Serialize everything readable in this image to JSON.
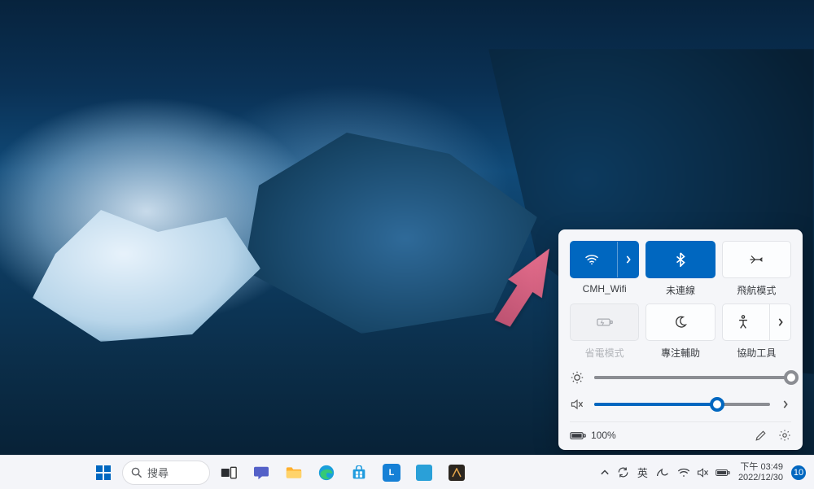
{
  "quick_settings": {
    "tiles": [
      {
        "key": "wifi",
        "label": "CMH_Wifi",
        "active": true,
        "split": true,
        "disabled": false
      },
      {
        "key": "bluetooth",
        "label": "未連線",
        "active": true,
        "split": false,
        "disabled": false
      },
      {
        "key": "airplane",
        "label": "飛航模式",
        "active": false,
        "split": false,
        "disabled": false
      },
      {
        "key": "battery-saver",
        "label": "省電模式",
        "active": false,
        "split": false,
        "disabled": true
      },
      {
        "key": "focus",
        "label": "專注輔助",
        "active": false,
        "split": false,
        "disabled": false
      },
      {
        "key": "accessibility",
        "label": "協助工具",
        "active": false,
        "split": true,
        "disabled": false
      }
    ],
    "brightness_pct": 100,
    "volume_pct": 70,
    "volume_muted": true,
    "battery_text": "100%"
  },
  "taskbar": {
    "search_placeholder": "搜尋",
    "ime_label": "英",
    "time_label": "下午 03:49",
    "date_label": "2022/12/30",
    "notification_count": "10"
  }
}
